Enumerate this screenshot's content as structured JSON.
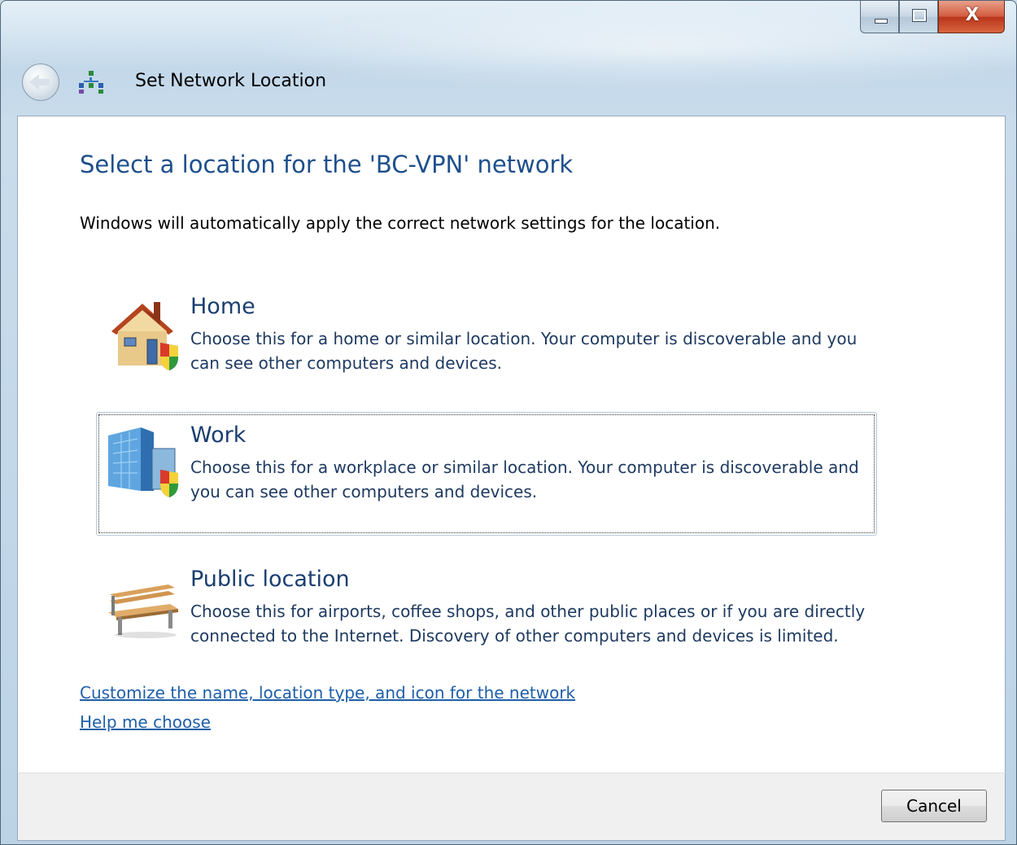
{
  "window": {
    "title": "Set Network Location",
    "caption_buttons": {
      "minimize": "minimize",
      "maximize": "maximize",
      "close": "X"
    }
  },
  "content": {
    "main_instruction": "Select a location for the 'BC-VPN' network",
    "description": "Windows will automatically apply the correct network settings for the location.",
    "options": [
      {
        "icon": "home-icon",
        "title": "Home",
        "description": "Choose this for a home or similar location. Your computer is discoverable and you can see other computers and devices.",
        "focused": false
      },
      {
        "icon": "work-building-icon",
        "title": "Work",
        "description": "Choose this for a workplace or similar location. Your computer is discoverable and you can see other computers and devices.",
        "focused": true
      },
      {
        "icon": "park-bench-icon",
        "title": "Public location",
        "description": "Choose this for airports, coffee shops, and other public places or if you are directly connected to the Internet. Discovery of other computers and devices is limited.",
        "focused": false
      }
    ],
    "links": {
      "customize": "Customize the name, location type, and icon for the network",
      "help": "Help me choose"
    }
  },
  "footer": {
    "cancel_label": "Cancel"
  },
  "colors": {
    "instruction_blue": "#1e4f8c",
    "option_title_blue": "#1a3e70",
    "link_blue": "#1f5fa8",
    "close_button_red": "#c8452a"
  }
}
